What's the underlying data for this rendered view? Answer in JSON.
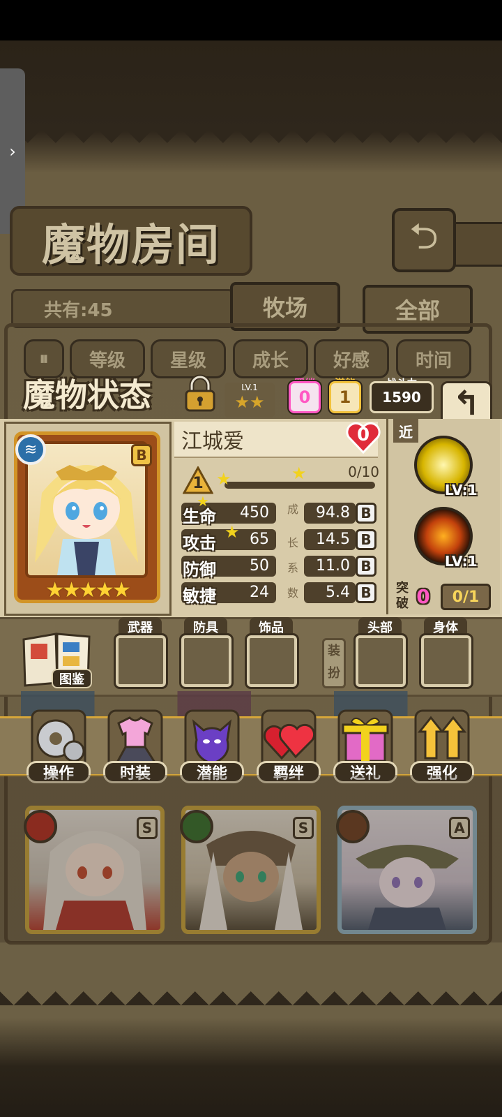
{
  "room": {
    "title": "魔物房间",
    "count": "共有:45"
  },
  "tabs": [
    {
      "label": "牧场"
    },
    {
      "label": "全部"
    }
  ],
  "sort": {
    "items": [
      "等级",
      "星级",
      "成长",
      "好感",
      "时间"
    ]
  },
  "status": {
    "title": "魔物状态",
    "stars_hint_level": "LV.1",
    "bond": {
      "label": "羁绊",
      "value": "0"
    },
    "potential": {
      "label": "潜能",
      "value": "1"
    },
    "power": {
      "label": "战斗力",
      "value": "1590"
    }
  },
  "monster": {
    "name": "江城爱",
    "rank": "B",
    "affection": "0",
    "level": "1",
    "xp": "0/10",
    "xp_fraction": 0,
    "card_stars": "★★★★★",
    "stats": [
      {
        "label": "生命",
        "value": "450",
        "growth": "94.8",
        "growth_rank": "B"
      },
      {
        "label": "攻击",
        "value": "65",
        "growth": "14.5",
        "growth_rank": "B"
      },
      {
        "label": "防御",
        "value": "50",
        "growth": "11.0",
        "growth_rank": "B"
      },
      {
        "label": "敏捷",
        "value": "24",
        "growth": "5.4",
        "growth_rank": "B"
      }
    ],
    "growth_label": [
      "成",
      "长",
      "系",
      "数"
    ]
  },
  "skills": {
    "range_tag": "近",
    "items": [
      {
        "level": "LV:1"
      },
      {
        "level": "LV:1"
      }
    ],
    "break": {
      "label": "突破",
      "value": "0",
      "progress": "0/1"
    }
  },
  "equipment": {
    "book_label": "图鉴",
    "slots": [
      {
        "label": "武器"
      },
      {
        "label": "防具"
      },
      {
        "label": "饰品"
      },
      {
        "label": "头部"
      },
      {
        "label": "身体"
      }
    ],
    "side_label": "装扮"
  },
  "actions": [
    {
      "label": "操作",
      "icon": "gear-icon"
    },
    {
      "label": "时装",
      "icon": "outfit-icon"
    },
    {
      "label": "潜能",
      "icon": "demon-icon"
    },
    {
      "label": "羁绊",
      "icon": "heart-icon"
    },
    {
      "label": "送礼",
      "icon": "gift-icon"
    },
    {
      "label": "强化",
      "icon": "upgrade-arrows-icon"
    }
  ],
  "monster_list": [
    {
      "rank": "S",
      "element": "fire",
      "element_color": "#b4291e"
    },
    {
      "rank": "S",
      "element": "leaf",
      "element_color": "#2f6d2a"
    },
    {
      "rank": "A",
      "element": "earth",
      "element_color": "#6b3b1f"
    }
  ],
  "colors": {
    "accent_gold": "#d6a63a",
    "bond_pink": "#ff58c3",
    "potential_gold": "#f2c23c"
  }
}
